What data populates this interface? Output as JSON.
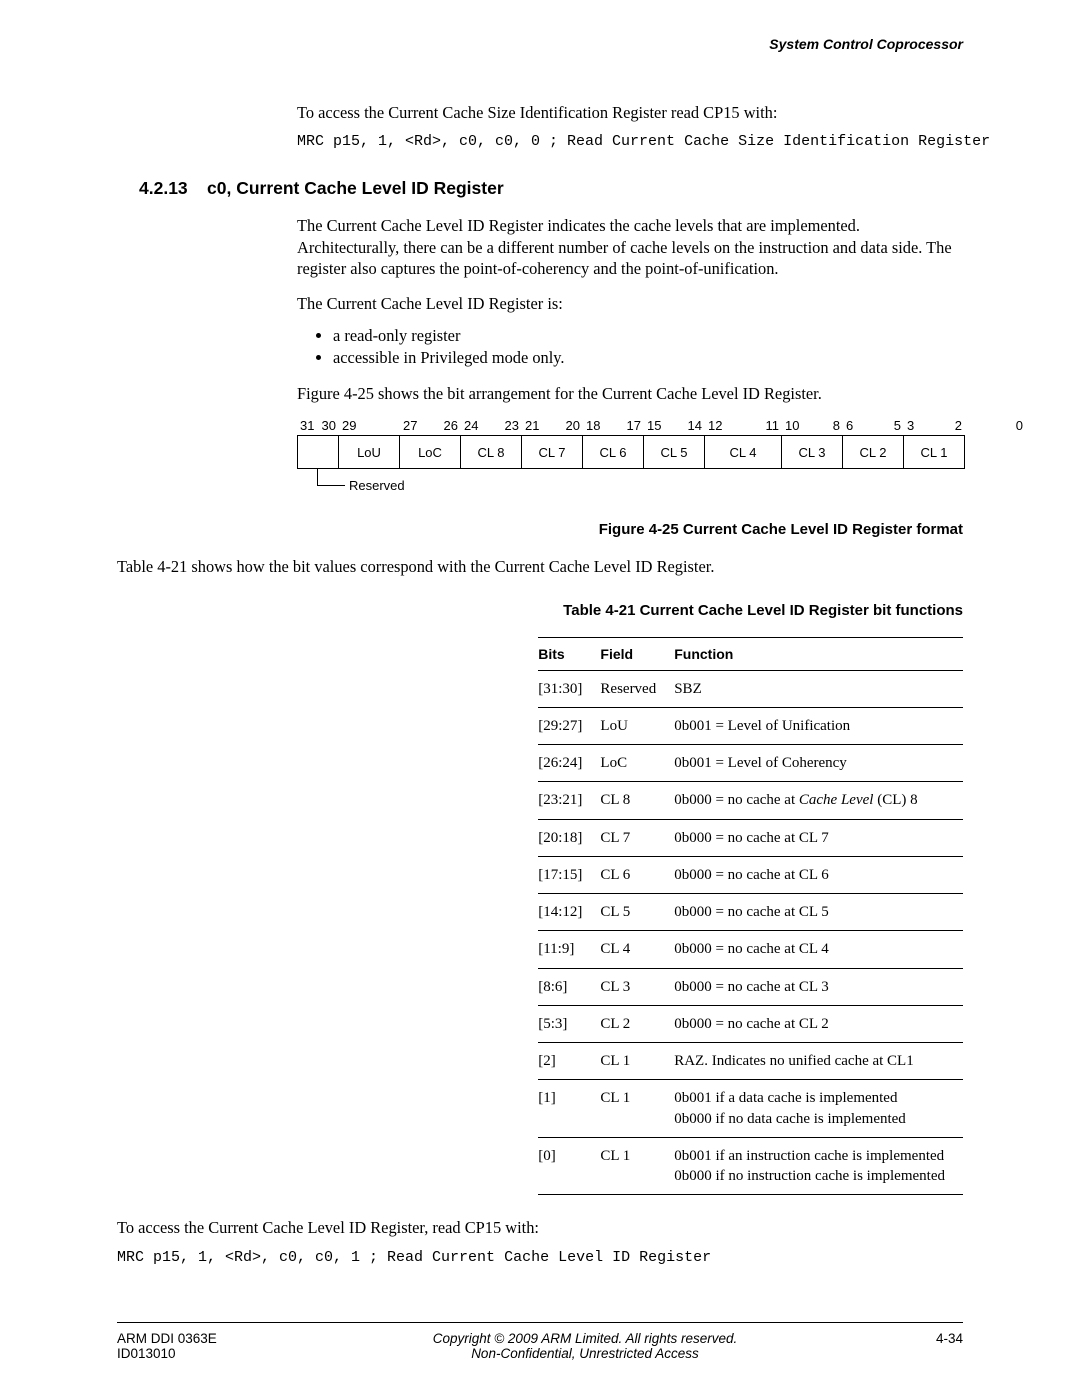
{
  "header": {
    "running": "System Control Coprocessor"
  },
  "intro": {
    "access_line": "To access the Current Cache Size Identification Register read CP15 with:",
    "code": "MRC p15, 1, <Rd>, c0, c0, 0 ; Read Current Cache Size Identification Register"
  },
  "section": {
    "num": "4.2.13",
    "title": "c0, Current Cache Level ID Register",
    "p1": "The Current Cache Level ID Register indicates the cache levels that are implemented. Architecturally, there can be a different number of cache levels on the instruction and data side. The register also captures the point-of-coherency and the point-of-unification.",
    "p2": "The Current Cache Level ID Register is:",
    "bullets": [
      "a read-only register",
      "accessible in Privileged mode only."
    ],
    "p3": "Figure 4-25 shows the bit arrangement for the Current Cache Level ID Register."
  },
  "register": {
    "bit_pairs": [
      [
        "31",
        "30"
      ],
      [
        "29",
        ""
      ],
      [
        "27",
        "26"
      ],
      [
        "24",
        "23"
      ],
      [
        "21",
        "20"
      ],
      [
        "18",
        "17"
      ],
      [
        "15",
        "14"
      ],
      [
        "12",
        "11"
      ],
      [
        "10",
        "8"
      ],
      [
        "6",
        "5"
      ],
      [
        "3",
        "2"
      ],
      [
        "",
        "0"
      ]
    ],
    "cells": [
      "",
      "LoU",
      "LoC",
      "CL 8",
      "CL 7",
      "CL 6",
      "CL 5",
      "CL 4",
      "CL 3",
      "CL 2",
      "CL 1"
    ],
    "reserved_label": "Reserved",
    "figure_caption": "Figure 4-25 Current Cache Level ID Register format"
  },
  "table_intro": "Table 4-21 shows how the bit values correspond with the Current Cache Level ID Register.",
  "table_caption": "Table 4-21 Current Cache Level ID Register bit functions",
  "table": {
    "headers": [
      "Bits",
      "Field",
      "Function"
    ],
    "rows": [
      {
        "bits": "[31:30]",
        "field": "Reserved",
        "func": "SBZ"
      },
      {
        "bits": "[29:27]",
        "field": "LoU",
        "func": "0b001 = Level of Unification"
      },
      {
        "bits": "[26:24]",
        "field": "LoC",
        "func": "0b001 = Level of Coherency"
      },
      {
        "bits": "[23:21]",
        "field": "CL 8",
        "func": "0b000 = no cache at <i>Cache Level</i> (CL) 8"
      },
      {
        "bits": "[20:18]",
        "field": "CL 7",
        "func": "0b000 = no cache at CL 7"
      },
      {
        "bits": "[17:15]",
        "field": "CL 6",
        "func": "0b000 = no cache at CL 6"
      },
      {
        "bits": "[14:12]",
        "field": "CL 5",
        "func": "0b000 = no cache at CL 5"
      },
      {
        "bits": "[11:9]",
        "field": "CL 4",
        "func": "0b000 = no cache at CL 4"
      },
      {
        "bits": "[8:6]",
        "field": "CL 3",
        "func": "0b000 = no cache at CL 3"
      },
      {
        "bits": "[5:3]",
        "field": "CL 2",
        "func": "0b000 = no cache at CL 2"
      },
      {
        "bits": "[2]",
        "field": "CL 1",
        "func": "RAZ. Indicates no unified cache at CL1"
      },
      {
        "bits": "[1]",
        "field": "CL 1",
        "func": "0b001 if a data cache is implemented<br>0b000 if no data cache is implemented"
      },
      {
        "bits": "[0]",
        "field": "CL 1",
        "func": "0b001 if an instruction cache is implemented<br>0b000 if no instruction cache is implemented"
      }
    ]
  },
  "outro": {
    "access_line": "To access the Current Cache Level ID Register, read CP15 with:",
    "code": "MRC p15, 1, <Rd>, c0, c0, 1 ; Read Current Cache Level ID Register"
  },
  "footer": {
    "left1": "ARM DDI 0363E",
    "left2": "ID013010",
    "center1": "Copyright © 2009 ARM Limited. All rights reserved.",
    "center2": "Non-Confidential, Unrestricted Access",
    "right": "4-34"
  }
}
